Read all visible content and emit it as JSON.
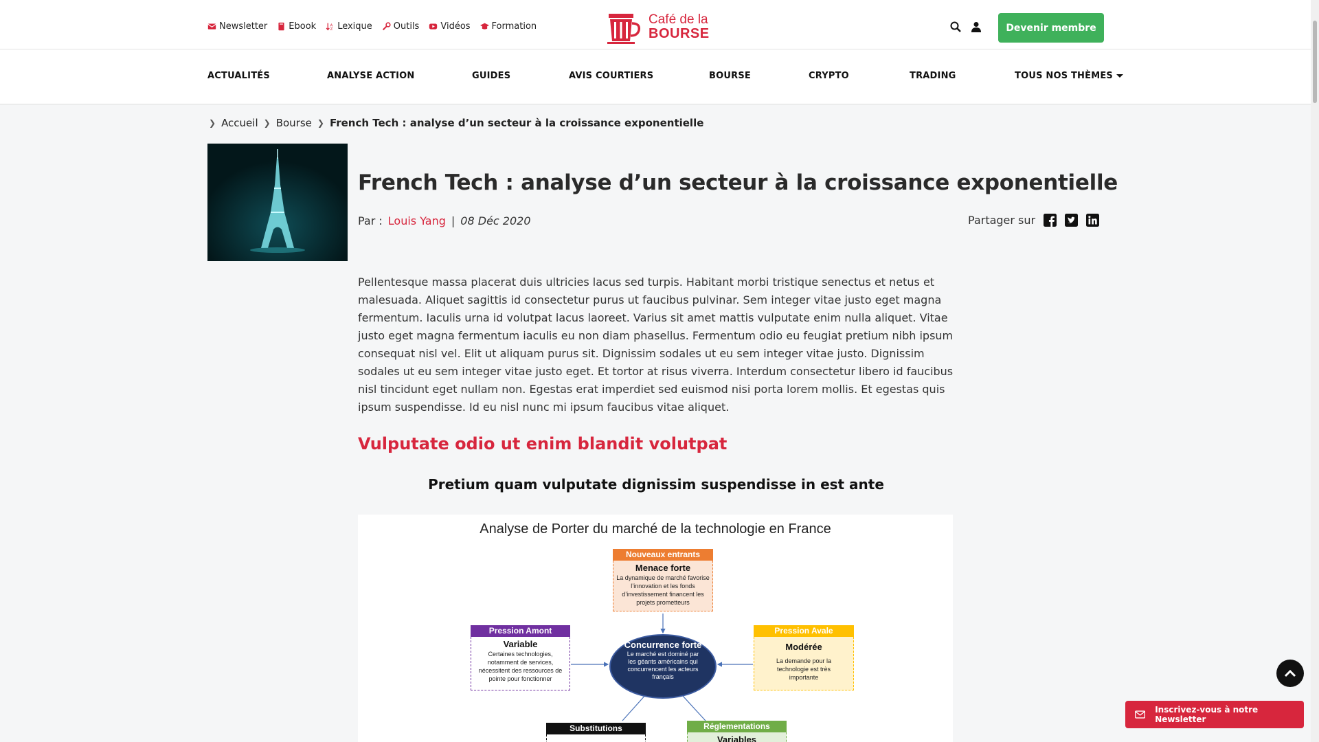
{
  "colors": {
    "brand_red": "#d7263d",
    "cta_green": "#3fb15b",
    "text_dark": "#2a2a2a"
  },
  "top_links": [
    {
      "icon": "envelope-icon",
      "label": "Newsletter"
    },
    {
      "icon": "book-icon",
      "label": "Ebook"
    },
    {
      "icon": "sort-icon",
      "label": "Lexique"
    },
    {
      "icon": "wrench-icon",
      "label": "Outils"
    },
    {
      "icon": "youtube-icon",
      "label": "Vidéos"
    },
    {
      "icon": "graduation-cap-icon",
      "label": "Formation"
    }
  ],
  "logo": {
    "line1": "Café de la",
    "line2": "BOURSE"
  },
  "header": {
    "cta_label": "Devenir membre"
  },
  "nav": [
    "ACTUALITÉS",
    "ANALYSE ACTION",
    "GUIDES",
    "AVIS COURTIERS",
    "BOURSE",
    "CRYPTO",
    "TRADING",
    "TOUS NOS THÈMES"
  ],
  "breadcrumb": {
    "home": "Accueil",
    "section": "Bourse",
    "current": "French Tech : analyse d’un secteur à la croissance exponentielle"
  },
  "article": {
    "title": "French Tech : analyse d’un secteur à la croissance exponentielle",
    "by_label": "Par :",
    "author": "Louis Yang",
    "date": "08 Déc 2020",
    "share_label": "Partager sur",
    "paragraph": "Pellentesque massa placerat duis ultricies lacus sed turpis. Habitant morbi tristique senectus et netus et malesuada. Aliquet sagittis id consectetur purus ut faucibus pulvinar. Sem integer vitae justo eget magna fermentum. Iaculis urna id volutpat lacus laoreet. Varius sit amet mattis vulputate enim nulla aliquet. Vitae justo eget magna fermentum iaculis eu non diam phasellus. Fermentum odio eu feugiat pretium nibh ipsum consequat nisl vel. Elit ut aliquam purus sit. Dignissim sodales ut eu sem integer vitae justo. Dignissim sodales ut eu sem integer vitae justo eget. Et tortor at risus viverra. Interdum consectetur libero id faucibus nisl tincidunt eget nullam non. Egestas erat imperdiet sed euismod nisi porta lorem mollis. Et egestas quis ipsum suspendisse. Id eu nisl nunc mi ipsum faucibus vitae aliquet.",
    "h2": "Vulputate odio ut enim blandit volutpat",
    "h3": "Pretium quam vulputate dignissim suspendisse in est ante"
  },
  "diagram": {
    "title": "Analyse de Porter du marché de la technologie en France",
    "center": {
      "title": "Concurrence forte",
      "text": "Le marché est dominé par les géants américains qui concurrencent les acteurs français"
    },
    "top": {
      "header": "Nouveaux entrants",
      "title": "Menace forte",
      "text": "La dynamique de marché favorise l’innovation et les fonds d’investissement financent les projets prometteurs",
      "color": "#ed7d31",
      "bg": "#fbe5d6"
    },
    "left": {
      "header": "Pression Amont",
      "title": "Variable",
      "text": "Certaines technologies, notamment de services, nécessitent des ressources de pointe pour fonctionner",
      "color": "#7030a0",
      "bg": "#ffffff"
    },
    "right": {
      "header": "Pression Avale",
      "title": "Modérée",
      "text": "La demande pour la technologie est très importante",
      "color": "#ffc000",
      "bg": "#fff2cc"
    },
    "bottom_left": {
      "header": "Substitutions",
      "color": "#111111"
    },
    "bottom_right": {
      "header": "Réglementations",
      "title": "Variables",
      "color": "#70ad47"
    }
  },
  "floating": {
    "newsletter_label": "Inscrivez-vous à notre Newsletter"
  }
}
